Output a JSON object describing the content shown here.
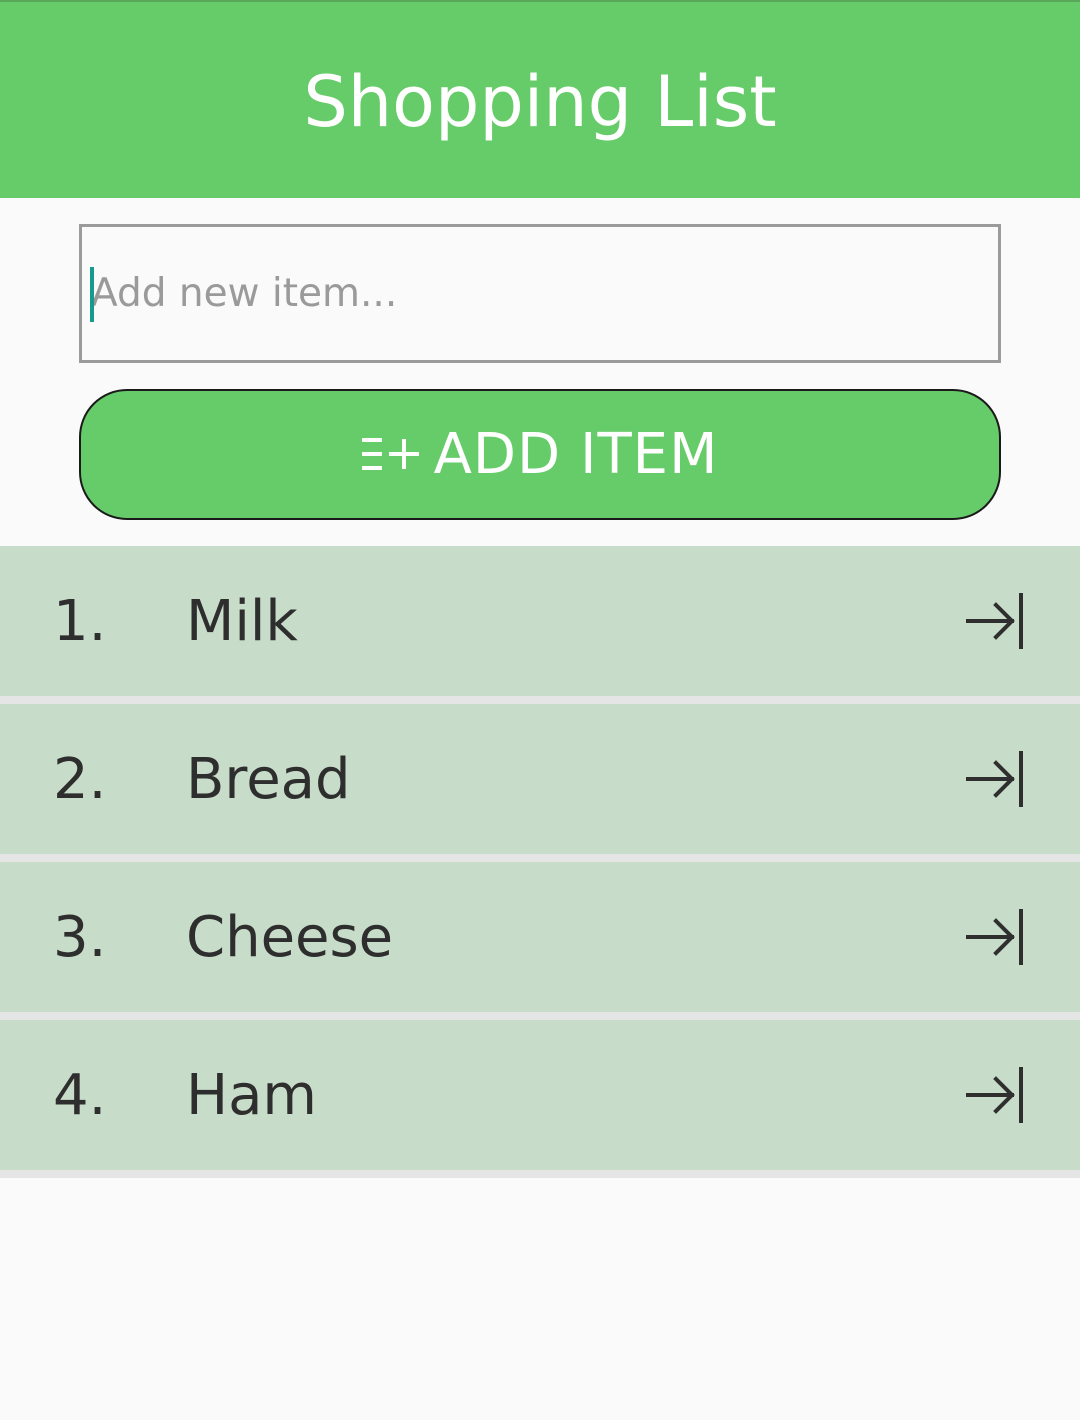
{
  "app": {
    "title": "Shopping List",
    "accent_color": "#66cb69"
  },
  "new_item": {
    "value": "",
    "placeholder": "Add new item..."
  },
  "add_button": {
    "label": "ADD ITEM",
    "icon": "playlist-add-icon"
  },
  "items": [
    {
      "number": "1.",
      "name": "Milk",
      "action_icon": "arrow-to-right-bar-icon"
    },
    {
      "number": "2.",
      "name": "Bread",
      "action_icon": "arrow-to-right-bar-icon"
    },
    {
      "number": "3.",
      "name": "Cheese",
      "action_icon": "arrow-to-right-bar-icon"
    },
    {
      "number": "4.",
      "name": "Ham",
      "action_icon": "arrow-to-right-bar-icon"
    }
  ]
}
